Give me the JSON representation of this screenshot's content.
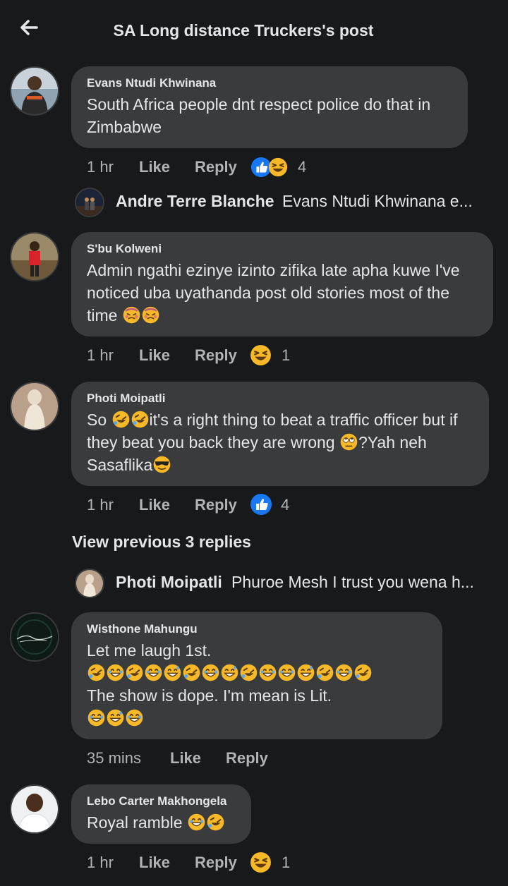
{
  "header": {
    "title": "SA Long distance Truckers's post"
  },
  "comments": [
    {
      "author": "Evans Ntudi Khwinana",
      "text": "South Africa people dnt respect police do that in Zimbabwe",
      "time": "1 hr",
      "like_label": "Like",
      "reply_label": "Reply",
      "reactions": [
        "like",
        "haha"
      ],
      "reaction_count": "4"
    },
    {
      "author": "S'bu Kolweni",
      "text": "Admin ngathi ezinye izinto zifika late apha kuwe I've noticed uba uyathanda post old stories most of the time",
      "text_emoji": [
        "woozy-face",
        "woozy-face"
      ],
      "time": "1 hr",
      "like_label": "Like",
      "reply_label": "Reply",
      "reactions": [
        "haha"
      ],
      "reaction_count": "1"
    },
    {
      "author": "Photi Moipatli",
      "text_parts": [
        "So ",
        "it's a right thing to beat a traffic officer but if they beat you back they are wrong ",
        "?Yah neh Sasaflika"
      ],
      "text_emoji": [
        "rofl",
        "rofl",
        "eye-roll",
        "sunglasses"
      ],
      "time": "1 hr",
      "like_label": "Like",
      "reply_label": "Reply",
      "reactions": [
        "like"
      ],
      "reaction_count": "4"
    },
    {
      "author": "Wisthone Mahungu",
      "text_line1": "Let me laugh 1st.",
      "text_line3": "The show is dope. I'm mean is Lit.",
      "time": "35 mins",
      "like_label": "Like",
      "reply_label": "Reply"
    },
    {
      "author": "Lebo Carter Makhongela",
      "text": "Royal ramble",
      "time": "1 hr",
      "like_label": "Like",
      "reply_label": "Reply",
      "reactions": [
        "haha"
      ],
      "reaction_count": "1"
    }
  ],
  "reply_previews": [
    {
      "author": "Andre Terre Blanche",
      "text": "Evans Ntudi Khwinana e..."
    },
    {
      "author": "Photi Moipatli",
      "text": "Phuroe Mesh I trust you wena h..."
    }
  ],
  "view_previous": "View previous 3 replies",
  "colors": {
    "background": "#18191a",
    "bubble": "#3a3b3c",
    "primary_text": "#e4e6eb",
    "secondary_text": "#b0b3b8",
    "like_blue": "#1877f2",
    "haha_yellow": "#f7b928"
  }
}
